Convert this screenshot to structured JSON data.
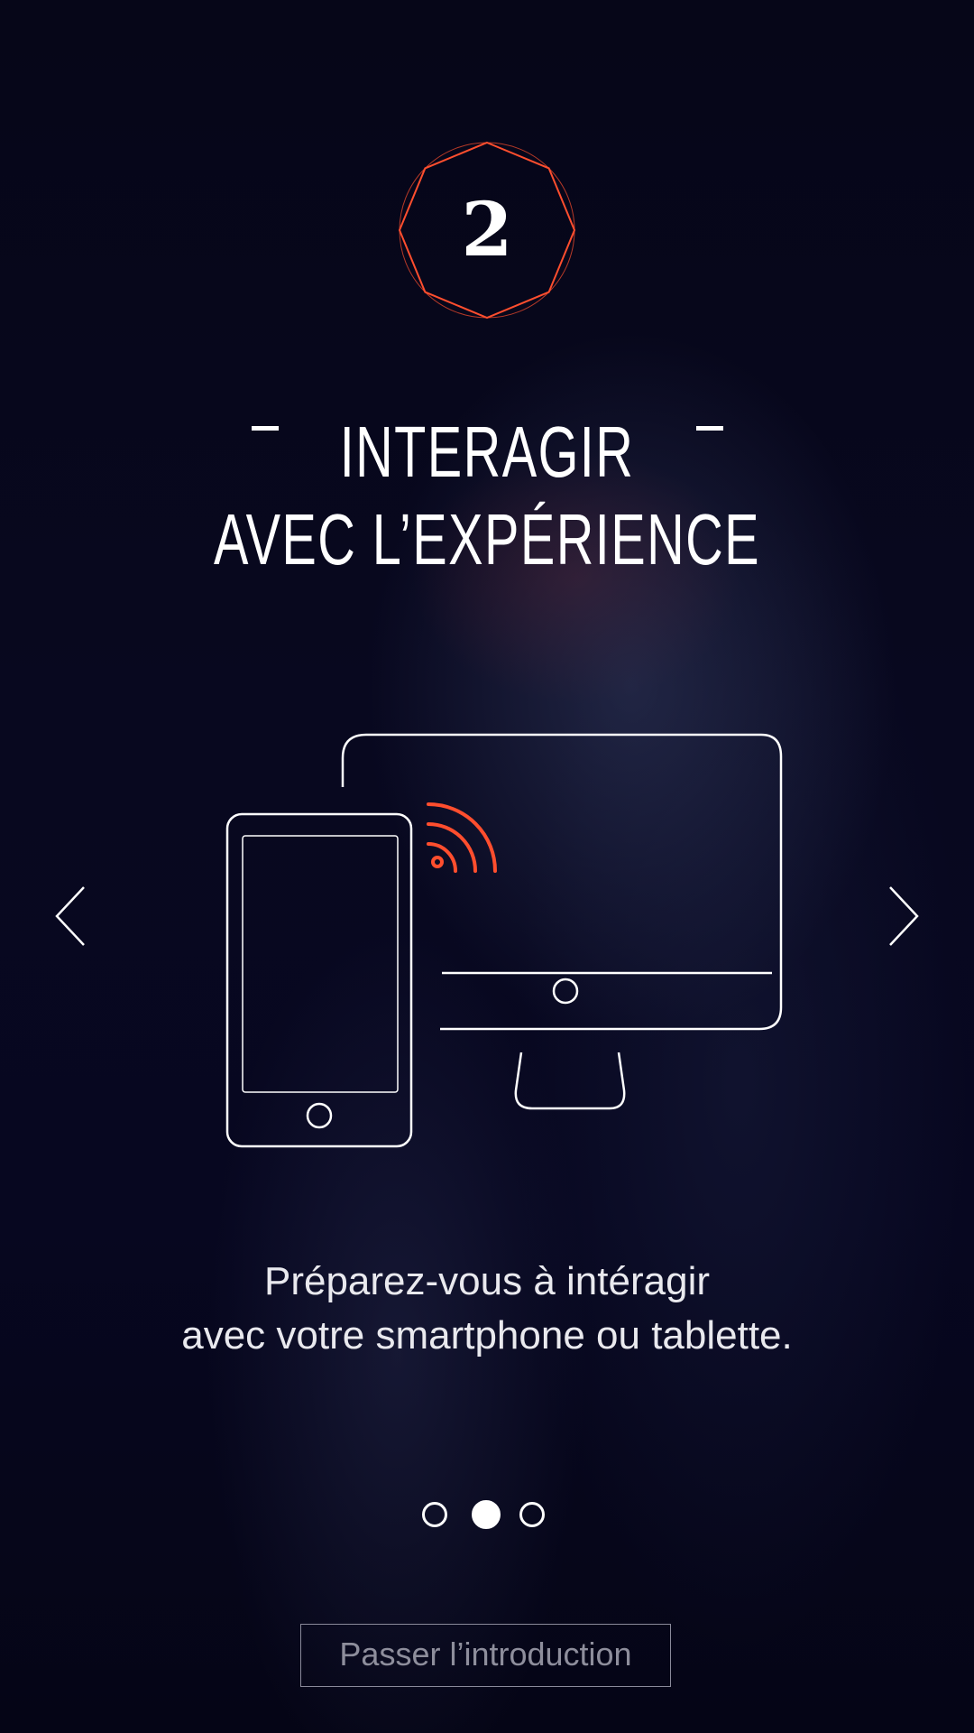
{
  "step": {
    "number": "2",
    "badge_color": "#ff4e2e"
  },
  "title": {
    "line1": "INTERAGIR",
    "line2": "AVEC L’EXPÉRIENCE",
    "dash": "-"
  },
  "illustration": {
    "icons": [
      "smartphone-icon",
      "monitor-icon",
      "wireless-signal-icon"
    ],
    "accent_color": "#ff4e2e",
    "line_color": "#ffffff"
  },
  "navigation": {
    "prev_icon": "chevron-left-icon",
    "next_icon": "chevron-right-icon"
  },
  "description": {
    "line1": "Préparez-vous à intéragir",
    "line2": "avec votre smartphone ou tablette."
  },
  "pager": {
    "total": 3,
    "active_index": 1
  },
  "skip_button": {
    "label": "Passer l’introduction"
  },
  "colors": {
    "background": "#06061a",
    "text": "#ffffff",
    "accent": "#ff4e2e",
    "muted": "#8e8e9c"
  }
}
